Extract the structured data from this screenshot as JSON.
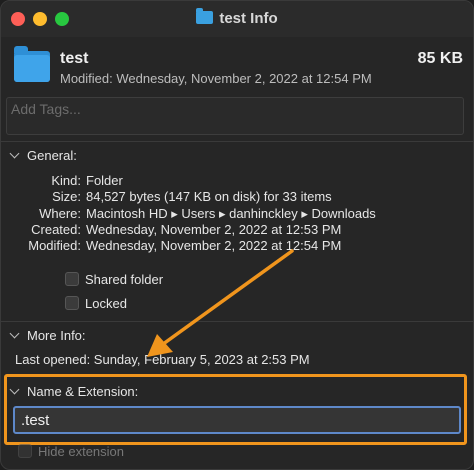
{
  "window": {
    "title": "test Info"
  },
  "header": {
    "name": "test",
    "size": "85 KB",
    "modified": "Modified: Wednesday, November 2, 2022 at 12:54 PM"
  },
  "tags": {
    "placeholder": "Add Tags..."
  },
  "general": {
    "heading": "General:",
    "rows": [
      {
        "key": "Kind:",
        "value": "Folder"
      },
      {
        "key": "Size:",
        "value": "84,527 bytes (147 KB on disk) for 33 items"
      },
      {
        "key": "Where:",
        "value": "Macintosh HD ▸ Users ▸ danhinckley ▸ Downloads"
      },
      {
        "key": "Created:",
        "value": "Wednesday, November 2, 2022 at 12:53 PM"
      },
      {
        "key": "Modified:",
        "value": "Wednesday, November 2, 2022 at 12:54 PM"
      }
    ],
    "shared_folder_label": "Shared folder",
    "locked_label": "Locked"
  },
  "more_info": {
    "heading": "More Info:",
    "last_opened": "Last opened: Sunday, February 5, 2023 at 2:53 PM"
  },
  "name_extension": {
    "heading": "Name & Extension:",
    "value": ".test",
    "hide_extension_label": "Hide extension"
  },
  "colors": {
    "annotation": "#f0951d",
    "folder": "#3fa4ea",
    "focus_ring": "#5e88c9"
  }
}
